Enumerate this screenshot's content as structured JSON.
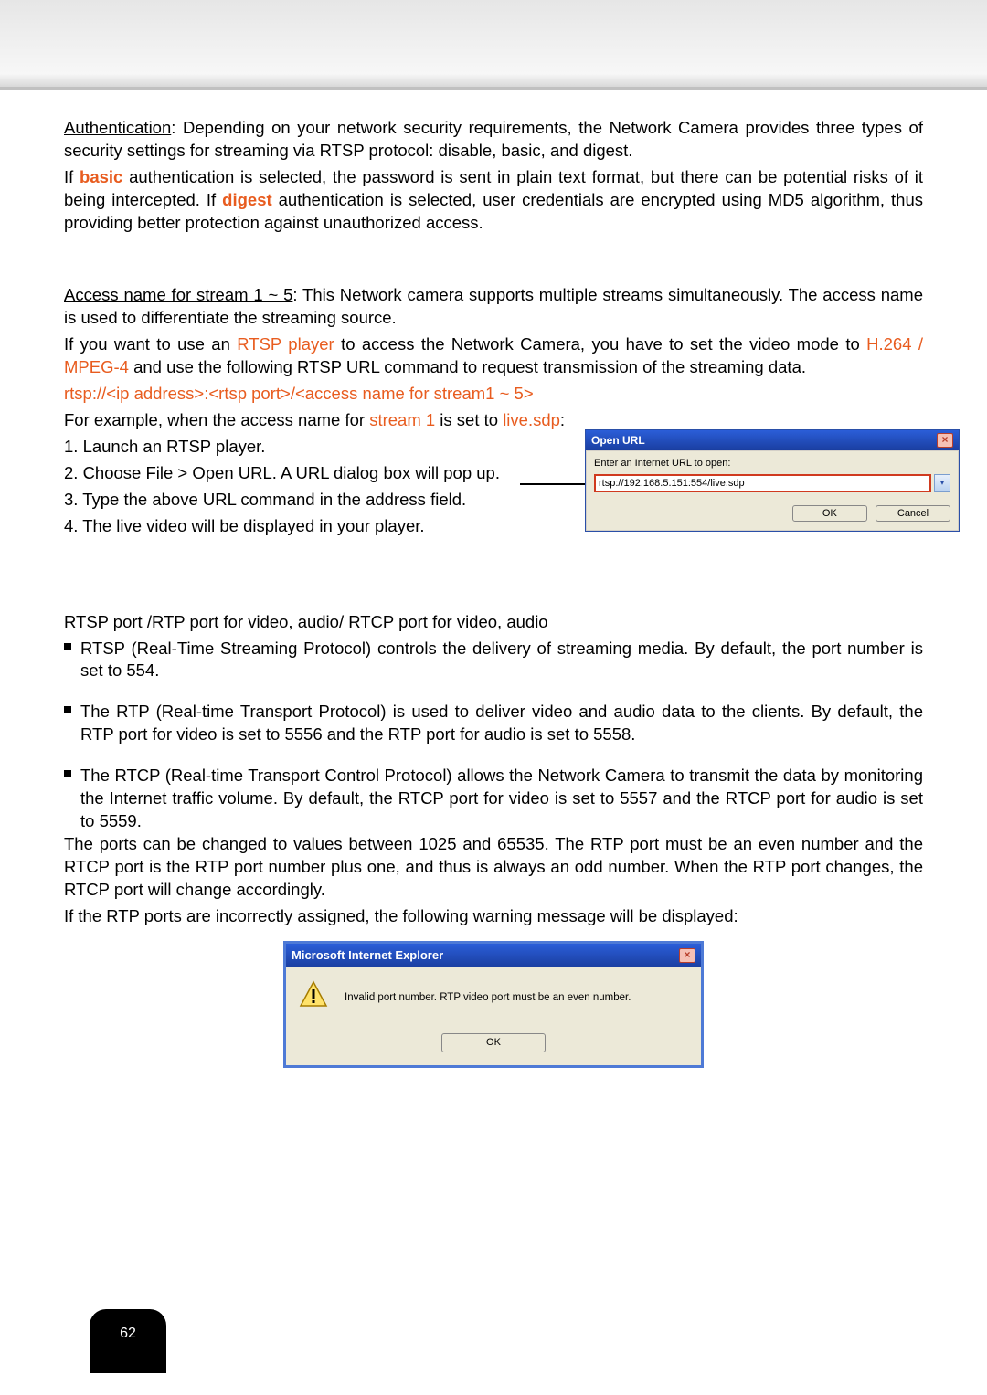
{
  "auth": {
    "heading": "Authentication",
    "text_after": ": Depending on your network security requirements, the Network Camera provides three types of security settings for streaming via RTSP protocol: disable, basic, and digest."
  },
  "basic": {
    "p1a": "If ",
    "basic_word": "basic",
    "p1b": " authentication is selected, the password is sent in plain text format, but there can be potential risks of it being intercepted. If ",
    "digest_word": "digest",
    "p1c": " authentication is selected, user credentials are encrypted using MD5 algorithm, thus providing better protection against unauthorized access."
  },
  "access": {
    "heading": "Access name for stream 1 ~ 5",
    "after": ": This Network camera supports multiple streams simultaneously. The access name is used to differentiate the streaming source."
  },
  "rtsp_player": {
    "p1a": "If you want to use an ",
    "player_word": "RTSP player",
    "p1b": " to access the Network Camera, you have to set the video mode to ",
    "codec_word": "H.264 / MPEG-4",
    "p1c": " and use the following RTSP URL command to request transmission of the streaming data."
  },
  "url_template": "rtsp://<ip address>:<rtsp port>/<access name for stream1 ~ 5>",
  "example": {
    "a": "For example, when the access name for ",
    "s1": "stream 1",
    "b": " is set to ",
    "sdp": "live.sdp",
    "c": ":"
  },
  "steps": {
    "s1": "1. Launch an RTSP player.",
    "s2": "2. Choose File > Open URL. A URL dialog box will pop up.",
    "s3": "3. Type the above URL command in the address field.",
    "s4": "4. The live video will be displayed in your player."
  },
  "open_url_dialog": {
    "title": "Open URL",
    "label": "Enter an Internet URL to open:",
    "value": "rtsp://192.168.5.151:554/live.sdp",
    "ok": "OK",
    "cancel": "Cancel"
  },
  "ports": {
    "heading": "RTSP port /RTP port for video, audio/ RTCP port for video, audio",
    "b1": "RTSP (Real-Time Streaming Protocol) controls the delivery of streaming media. By default, the port number is set to 554.",
    "b2": "The RTP (Real-time Transport Protocol) is used to deliver video and audio data to the clients. By default, the RTP port for video is set to 5556 and the RTP port for audio is set to 5558.",
    "b3": "The RTCP (Real-time Transport Control Protocol) allows the Network Camera to transmit the data by monitoring the Internet traffic volume. By default, the RTCP port for video is set to 5557 and the RTCP port for audio is set to 5559.",
    "p2": "The ports can be changed to values between 1025 and 65535. The RTP port must be an even number and the RTCP port is the RTP port number plus one, and thus is always an odd number. When the RTP port changes, the RTCP port will change accordingly.",
    "p3": "If the RTP ports are incorrectly assigned, the following warning message will be displayed:"
  },
  "warning_dialog": {
    "title": "Microsoft Internet Explorer",
    "message": "Invalid port number. RTP video port must be an even number.",
    "ok": "OK"
  },
  "page_number": "62"
}
